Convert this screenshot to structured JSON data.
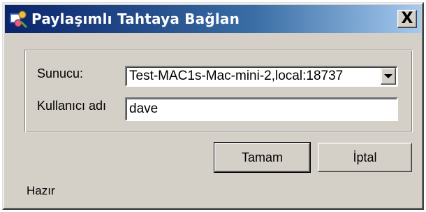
{
  "window": {
    "title": "Paylaşımlı Tahtaya Bağlan",
    "close_label": "X"
  },
  "form": {
    "server_label": "Sunucu:",
    "server_value": "Test-MAC1s-Mac-mini-2,local:18737",
    "username_label": "Kullanıcı adı",
    "username_value": "dave"
  },
  "buttons": {
    "ok_label": "Tamam",
    "cancel_label": "İptal"
  },
  "status": {
    "text": "Hazır"
  },
  "icons": {
    "title_icon": "shared-whiteboard-icon",
    "dropdown": "chevron-down-icon"
  }
}
